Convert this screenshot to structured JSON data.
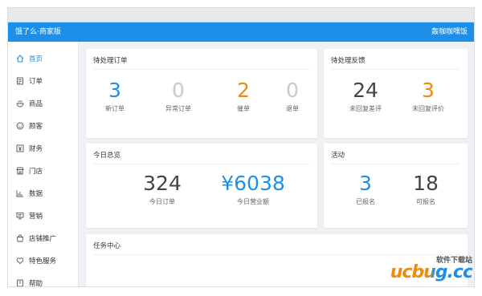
{
  "header": {
    "brand": "饿了么·商家版",
    "store": "轰咖咖嘿饭"
  },
  "colors": {
    "blue": "#1d8fe8",
    "gray": "#c9c9c9",
    "orange": "#f08a0a",
    "dark": "#444444"
  },
  "sidebar": {
    "items": [
      {
        "label": "首页",
        "icon": "home-icon"
      },
      {
        "label": "订单",
        "icon": "order-icon"
      },
      {
        "label": "商品",
        "icon": "product-icon"
      },
      {
        "label": "顾客",
        "icon": "smile-icon"
      },
      {
        "label": "财务",
        "icon": "yen-icon"
      },
      {
        "label": "门店",
        "icon": "store-icon"
      },
      {
        "label": "数据",
        "icon": "chart-icon"
      },
      {
        "label": "营销",
        "icon": "marketing-icon"
      },
      {
        "label": "店铺推广",
        "icon": "bag-icon"
      },
      {
        "label": "特色服务",
        "icon": "heart-icon"
      },
      {
        "label": "帮助",
        "icon": "help-icon"
      }
    ]
  },
  "pending_orders": {
    "title": "待处理订单",
    "stats": [
      {
        "value": "3",
        "label": "新订单"
      },
      {
        "value": "0",
        "label": "异常订单"
      },
      {
        "value": "2",
        "label": "催单"
      },
      {
        "value": "0",
        "label": "退单"
      }
    ]
  },
  "pending_feedback": {
    "title": "待处理反馈",
    "stats": [
      {
        "value": "24",
        "label": "未回复差评"
      },
      {
        "value": "3",
        "label": "未回复评价"
      }
    ]
  },
  "today": {
    "title": "今日总览",
    "stats": [
      {
        "value": "324",
        "label": "今日订单"
      },
      {
        "value": "¥6038",
        "label": "今日营业额"
      }
    ]
  },
  "activity": {
    "title": "活动",
    "stats": [
      {
        "value": "3",
        "label": "已报名"
      },
      {
        "value": "18",
        "label": "可报名"
      }
    ]
  },
  "tasks": {
    "title": "任务中心"
  },
  "watermark": {
    "cn": "软件下载站",
    "en": "ucbug.cc"
  }
}
